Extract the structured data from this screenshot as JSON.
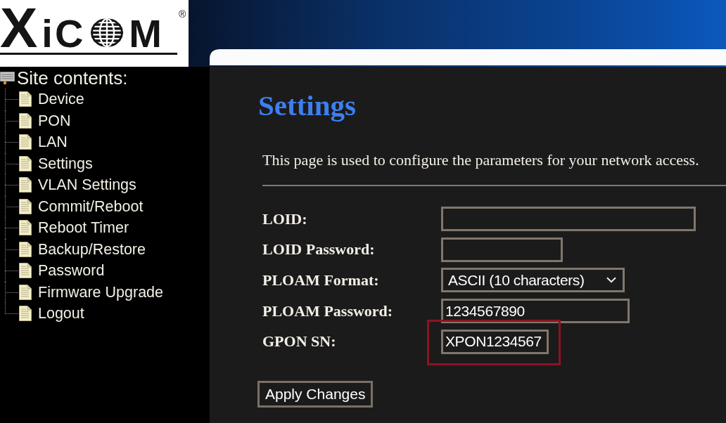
{
  "header": {
    "logo": {
      "initial": "X",
      "letters": "iC",
      "final": "M",
      "trademark": "®"
    }
  },
  "sidebar": {
    "title": "Site contents:",
    "items": [
      {
        "label": "Device"
      },
      {
        "label": "PON"
      },
      {
        "label": "LAN"
      },
      {
        "label": "Settings"
      },
      {
        "label": "VLAN Settings"
      },
      {
        "label": "Commit/Reboot"
      },
      {
        "label": "Reboot Timer"
      },
      {
        "label": "Backup/Restore"
      },
      {
        "label": "Password"
      },
      {
        "label": "Firmware Upgrade"
      },
      {
        "label": "Logout"
      }
    ]
  },
  "page": {
    "title": "Settings",
    "description": "This page is used to configure the parameters for your network access."
  },
  "form": {
    "fields": [
      {
        "kind": "text",
        "label": "LOID:",
        "highlighted": false
      },
      {
        "kind": "text",
        "label": "LOID Password:",
        "highlighted": false
      },
      {
        "kind": "select",
        "label": "PLOAM Format:",
        "value": "ASCII (10 characters)",
        "highlighted": false
      },
      {
        "kind": "text",
        "label": "PLOAM Password:",
        "value": "1234567890",
        "highlighted": false
      },
      {
        "kind": "text",
        "label": "GPON SN:",
        "value": "XPON1234567",
        "highlighted": true
      }
    ]
  },
  "buttons": [
    {
      "label": "Apply Changes"
    }
  ]
}
